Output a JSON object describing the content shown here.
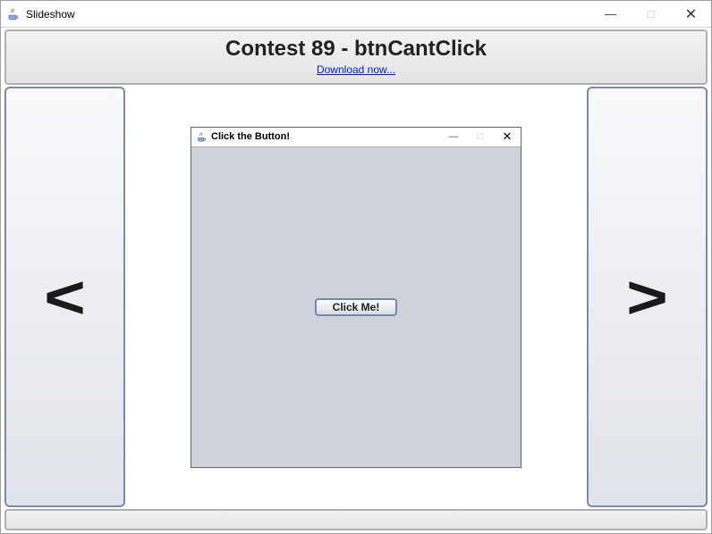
{
  "outerWindow": {
    "title": "Slideshow",
    "controls": {
      "minimize": "—",
      "maximize": "□",
      "close": "✕"
    }
  },
  "header": {
    "title": "Contest 89 - btnCantClick",
    "downloadLink": "Download now..."
  },
  "nav": {
    "prev": "<",
    "next": ">"
  },
  "innerWindow": {
    "title": "Click the Button!",
    "controls": {
      "minimize": "—",
      "maximize": "□",
      "close": "✕"
    },
    "button": "Click Me!"
  }
}
